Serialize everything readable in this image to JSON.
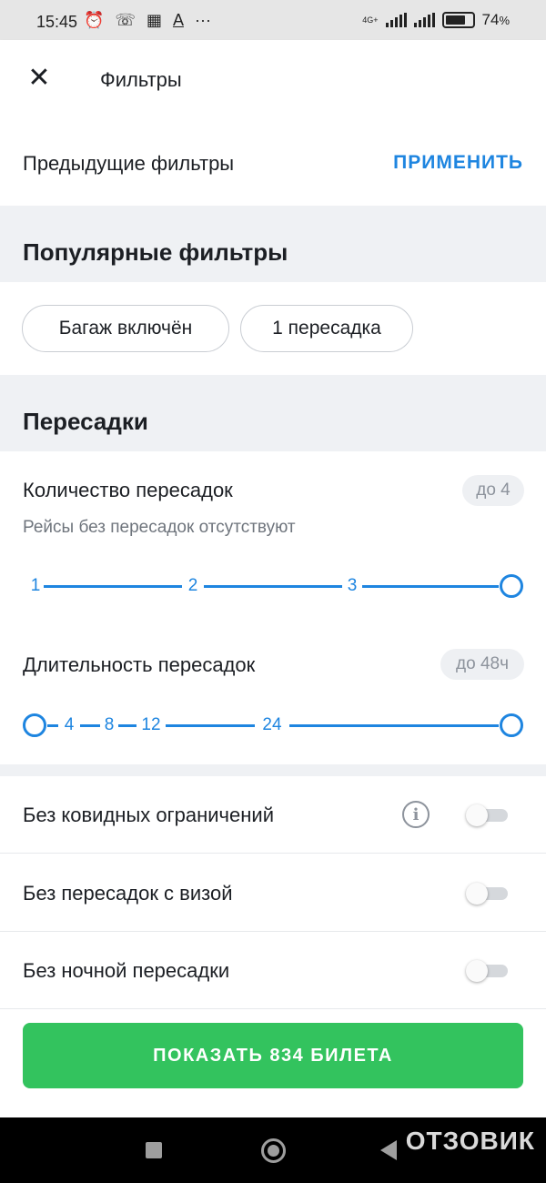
{
  "status_bar": {
    "time": "15:45",
    "network": "4G+",
    "battery": "74",
    "battery_suffix": "%",
    "battery_level": 0.74,
    "icons": [
      "alarm-icon",
      "missed-call-icon",
      "qr-icon",
      "text-icon",
      "more-icon"
    ]
  },
  "header": {
    "close_icon": "close-icon",
    "title": "Фильтры"
  },
  "previous_filters": {
    "label": "Предыдущие фильтры",
    "apply": "ПРИМЕНИТЬ"
  },
  "popular": {
    "title": "Популярные фильтры",
    "chips": [
      "Багаж включён",
      "1 пересадка"
    ]
  },
  "transfers": {
    "title": "Пересадки",
    "count": {
      "label": "Количество пересадок",
      "badge": "до 4",
      "hint": "Рейсы без пересадок отсутствуют",
      "ticks": [
        "1",
        "2",
        "3"
      ],
      "selected_max": 4
    },
    "duration": {
      "label": "Длительность пересадок",
      "badge": "до 48ч",
      "ticks": [
        "4",
        "8",
        "12",
        "24"
      ],
      "selected_max_hours": 48
    }
  },
  "toggles": [
    {
      "label": "Без ковидных ограничений",
      "on": false,
      "info_icon": "info-icon"
    },
    {
      "label": "Без пересадок с визой",
      "on": false
    },
    {
      "label": "Без ночной пересадки",
      "on": false
    }
  ],
  "show_button": "ПОКАЗАТЬ 834 БИЛЕТА",
  "colors": {
    "accent": "#1e85e0",
    "button": "#33c35e",
    "section_bg": "#eff1f4"
  },
  "watermark": "ОТЗОВИК"
}
